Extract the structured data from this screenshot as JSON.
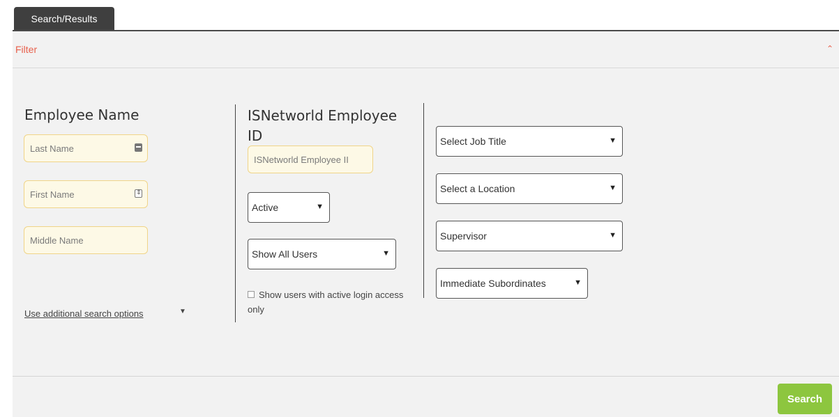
{
  "tabs": [
    {
      "label": "Search/Results"
    }
  ],
  "filter": {
    "title": "Filter",
    "collapse_icon": "chevron-up-icon"
  },
  "employee_name": {
    "heading": "Employee Name",
    "last_name": {
      "placeholder": "Last Name",
      "icon": "contact-card-icon"
    },
    "first_name": {
      "placeholder": "First Name",
      "icon": "spinner-icon"
    },
    "middle_name": {
      "placeholder": "Middle Name"
    },
    "additional_options": "Use additional search options"
  },
  "isn_id": {
    "heading_line1": "ISNetworld Employee",
    "heading_line2": "ID",
    "placeholder": "ISNetworld Employee II",
    "status_select": "Active",
    "users_select": "Show All Users",
    "checkbox_label": "Show users with active login access only",
    "checkbox_checked": false
  },
  "filters": {
    "job_title": "Select Job Title",
    "location": "Select a Location",
    "supervisor": "Supervisor",
    "subordinates": "Immediate Subordinates"
  },
  "actions": {
    "search": "Search"
  },
  "colors": {
    "tab_bg": "#3f3f3f",
    "filter_accent": "#e8604c",
    "panel_bg": "#f2f2f2",
    "input_bg": "#fdf9e6",
    "input_border": "#f0d488",
    "search_button": "#8dc63f"
  }
}
